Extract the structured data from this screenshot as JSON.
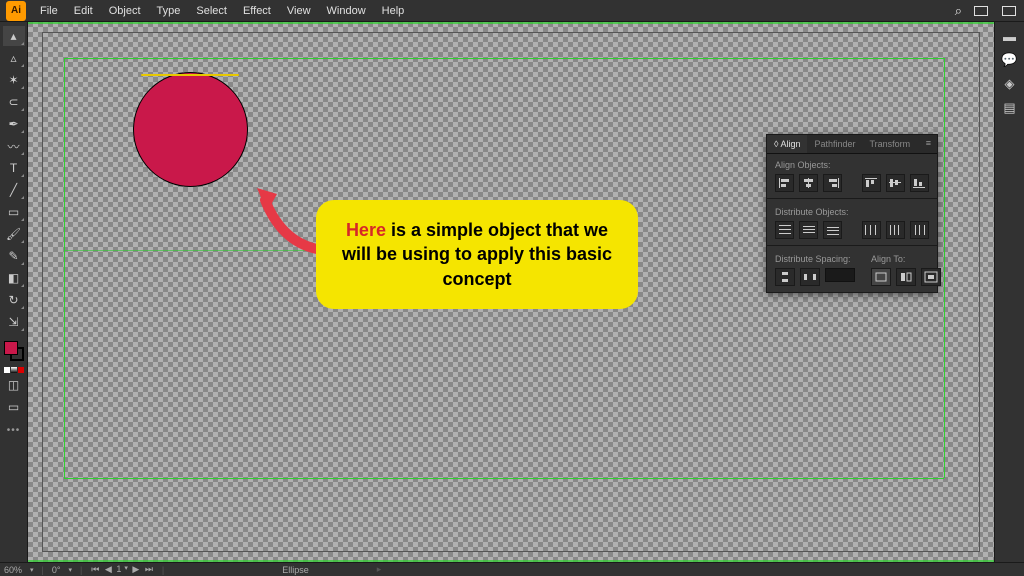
{
  "app": {
    "icon_label": "Ai"
  },
  "menu": [
    "File",
    "Edit",
    "Object",
    "Type",
    "Select",
    "Effect",
    "View",
    "Window",
    "Help"
  ],
  "tools": [
    {
      "name": "selection",
      "glyph": "▴"
    },
    {
      "name": "direct-selection",
      "glyph": "▵"
    },
    {
      "name": "magic-wand",
      "glyph": "✶"
    },
    {
      "name": "lasso",
      "glyph": "⊂"
    },
    {
      "name": "pen",
      "glyph": "✒"
    },
    {
      "name": "curvature",
      "glyph": "〰"
    },
    {
      "name": "type",
      "glyph": "T"
    },
    {
      "name": "line",
      "glyph": "╱"
    },
    {
      "name": "rectangle",
      "glyph": "▭"
    },
    {
      "name": "brush",
      "glyph": "🖌"
    },
    {
      "name": "shaper",
      "glyph": "✎"
    },
    {
      "name": "eraser",
      "glyph": "◧"
    },
    {
      "name": "rotate",
      "glyph": "↻"
    },
    {
      "name": "scale",
      "glyph": "⇲"
    },
    {
      "name": "width",
      "glyph": "⇔"
    },
    {
      "name": "free-transform",
      "glyph": "✥"
    },
    {
      "name": "shape-builder",
      "glyph": "◫"
    },
    {
      "name": "perspective",
      "glyph": "▦"
    },
    {
      "name": "mesh",
      "glyph": "▩"
    },
    {
      "name": "gradient",
      "glyph": "◐"
    },
    {
      "name": "eyedropper",
      "glyph": "✐"
    },
    {
      "name": "blend",
      "glyph": "◑"
    },
    {
      "name": "symbol-sprayer",
      "glyph": "❋"
    },
    {
      "name": "graph",
      "glyph": "▤"
    },
    {
      "name": "artboard",
      "glyph": "▢"
    },
    {
      "name": "slice",
      "glyph": "⊘"
    },
    {
      "name": "hand",
      "glyph": "✋"
    },
    {
      "name": "zoom",
      "glyph": "🔍"
    }
  ],
  "align_panel": {
    "tabs": [
      "Align",
      "Pathfinder",
      "Transform"
    ],
    "sec1": "Align Objects:",
    "sec2": "Distribute Objects:",
    "sec3": "Distribute Spacing:",
    "sec4": "Align To:"
  },
  "callout": {
    "word1": "Here",
    "rest": " is a simple object that we will be using to apply this basic concept"
  },
  "status": {
    "zoom": "60%",
    "rotate": "0°",
    "artboard_nav": "1",
    "selection": "Ellipse"
  }
}
